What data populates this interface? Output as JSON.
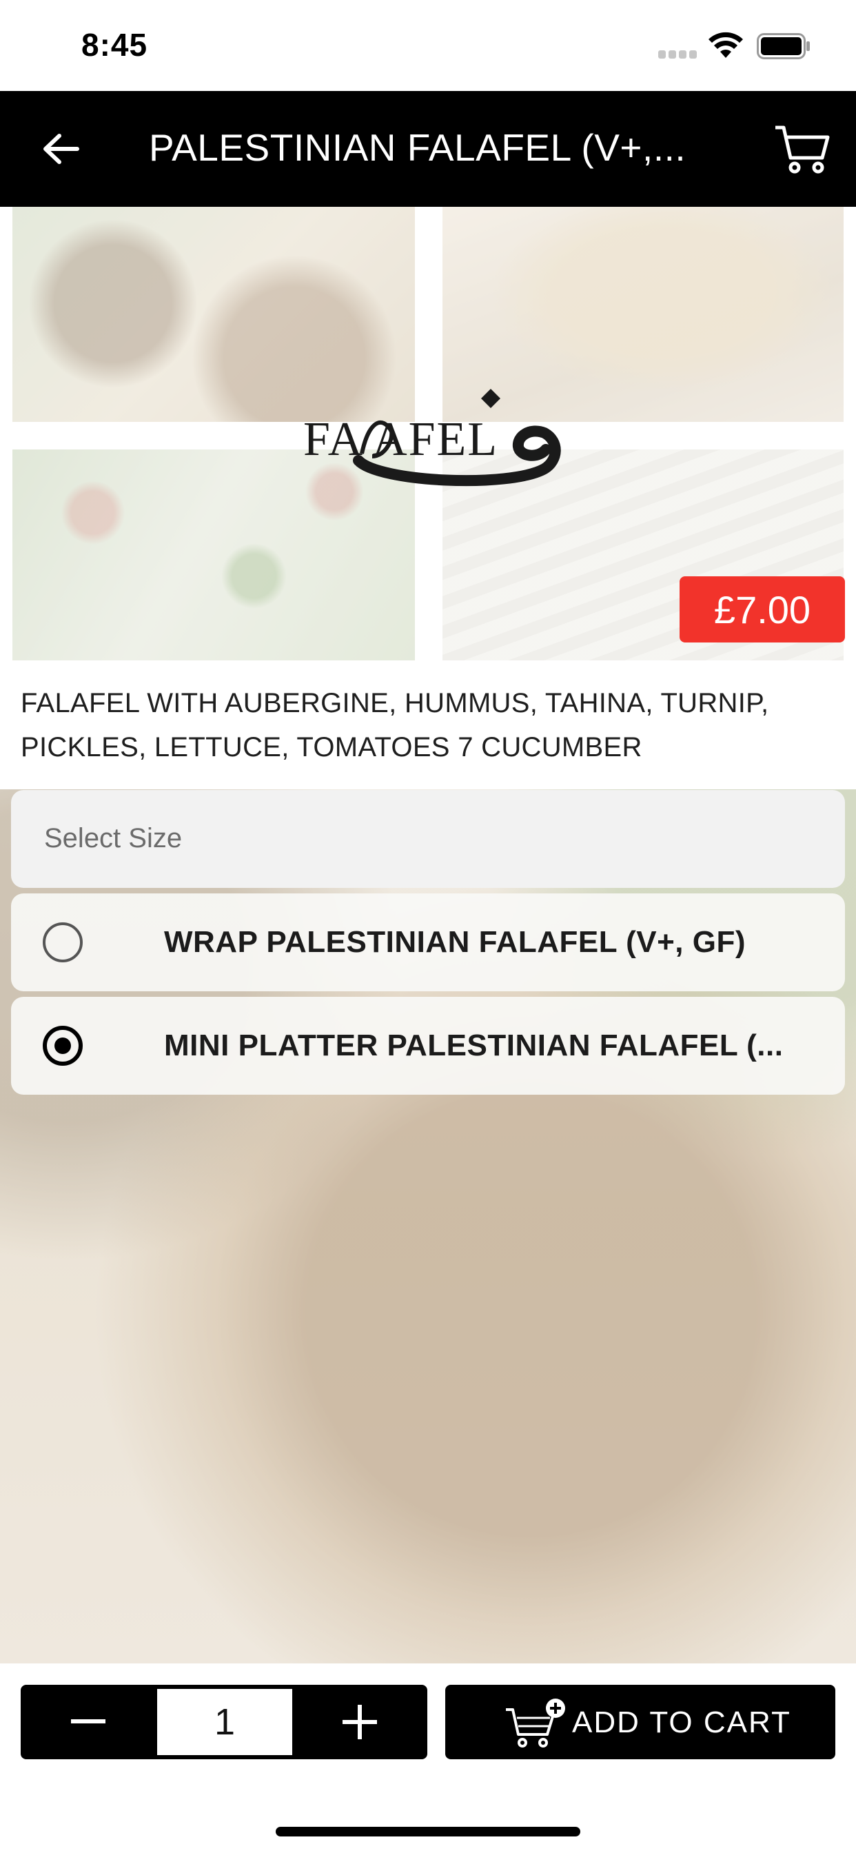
{
  "status_bar": {
    "time": "8:45"
  },
  "header": {
    "title": "PALESTINIAN FALAFEL (V+,..."
  },
  "hero": {
    "logo_text": "FA AFEL",
    "price": "£7.00"
  },
  "description": "FALAFEL WITH AUBERGINE, HUMMUS, TAHINA, TURNIP, PICKLES, LETTUCE, TOMATOES 7 CUCUMBER",
  "size_selector": {
    "header": "Select Size",
    "options": [
      {
        "label": "WRAP PALESTINIAN FALAFEL (V+, GF)",
        "selected": false
      },
      {
        "label": "MINI PLATTER PALESTINIAN FALAFEL (...",
        "selected": true
      }
    ]
  },
  "bottom_bar": {
    "quantity": "1",
    "add_to_cart_label": "ADD TO CART"
  },
  "icons": [
    "back-arrow-icon",
    "cart-icon",
    "wifi-icon",
    "battery-icon",
    "minus-icon",
    "plus-icon",
    "add-to-cart-icon"
  ],
  "colors": {
    "header_bg": "#000000",
    "price_badge": "#f2332b",
    "button_bg": "#000000"
  }
}
